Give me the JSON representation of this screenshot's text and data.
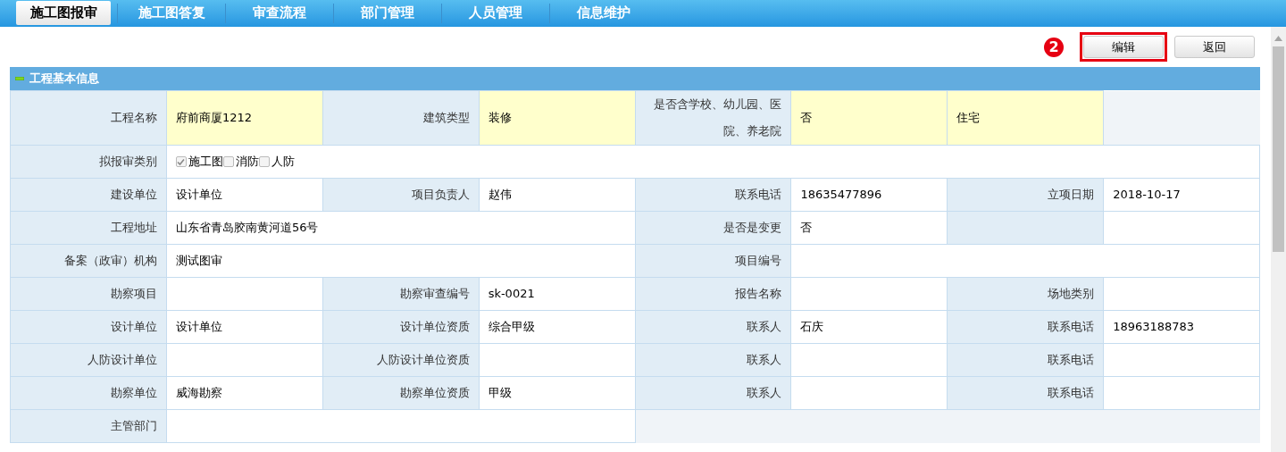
{
  "nav": {
    "tabs": [
      {
        "label": "施工图报审",
        "selected": true
      },
      {
        "label": "施工图答复",
        "selected": false
      },
      {
        "label": "审查流程",
        "selected": false
      },
      {
        "label": "部门管理",
        "selected": false
      },
      {
        "label": "人员管理",
        "selected": false
      },
      {
        "label": "信息维护",
        "selected": false
      }
    ]
  },
  "step_badge": "2",
  "buttons": [
    {
      "label": "编辑",
      "highlighted": true
    },
    {
      "label": "返回",
      "highlighted": false
    }
  ],
  "section": {
    "title": "工程基本信息",
    "expanded": true
  },
  "rows": [
    {
      "cells": [
        {
          "kind": "label",
          "text": "工程名称"
        },
        {
          "kind": "value",
          "text": "府前商厦1212",
          "highlighted": true
        },
        {
          "kind": "label",
          "text": "建筑类型"
        },
        {
          "kind": "value",
          "text": "装修",
          "highlighted": true
        },
        {
          "kind": "label",
          "text": "是否含学校、幼儿园、医院、养老院"
        },
        {
          "kind": "value",
          "text": "否",
          "highlighted": true
        },
        {
          "kind": "value",
          "text": "住宅",
          "highlighted": true
        }
      ]
    },
    {
      "cells": [
        {
          "kind": "label",
          "text": "拟报审类别"
        },
        {
          "kind": "checks",
          "options": [
            {
              "label": "施工图",
              "checked": true
            },
            {
              "label": "消防",
              "checked": false
            },
            {
              "label": "人防",
              "checked": false
            }
          ]
        }
      ]
    },
    {
      "cells": [
        {
          "kind": "label",
          "text": "建设单位"
        },
        {
          "kind": "value",
          "text": "设计单位"
        },
        {
          "kind": "label",
          "text": "项目负责人"
        },
        {
          "kind": "value",
          "text": "赵伟"
        },
        {
          "kind": "label",
          "text": "联系电话"
        },
        {
          "kind": "value",
          "text": "18635477896"
        },
        {
          "kind": "label",
          "text": "立项日期"
        },
        {
          "kind": "value",
          "text": "2018-10-17"
        }
      ]
    },
    {
      "cells": [
        {
          "kind": "label",
          "text": "工程地址"
        },
        {
          "kind": "wide",
          "text": "山东省青岛胶南黄河道56号"
        },
        {
          "kind": "label",
          "text": "是否是变更"
        },
        {
          "kind": "value",
          "text": "否"
        },
        {
          "kind": "label"
        },
        {
          "kind": "value"
        }
      ]
    },
    {
      "cells": [
        {
          "kind": "label",
          "text": "备案（政审）机构"
        },
        {
          "kind": "wide",
          "text": "测试图审"
        },
        {
          "kind": "label",
          "text": "项目编号"
        },
        {
          "kind": "wide"
        }
      ]
    },
    {
      "cells": [
        {
          "kind": "label",
          "text": "勘察项目"
        },
        {
          "kind": "value"
        },
        {
          "kind": "label",
          "text": "勘察审查编号"
        },
        {
          "kind": "value",
          "text": "sk-0021"
        },
        {
          "kind": "label",
          "text": "报告名称"
        },
        {
          "kind": "value"
        },
        {
          "kind": "label",
          "text": "场地类别"
        },
        {
          "kind": "value"
        }
      ]
    },
    {
      "cells": [
        {
          "kind": "label",
          "text": "设计单位"
        },
        {
          "kind": "value",
          "text": "设计单位"
        },
        {
          "kind": "label",
          "text": "设计单位资质"
        },
        {
          "kind": "value",
          "text": "综合甲级"
        },
        {
          "kind": "label",
          "text": "联系人"
        },
        {
          "kind": "value",
          "text": "石庆"
        },
        {
          "kind": "label",
          "text": "联系电话"
        },
        {
          "kind": "value",
          "text": "18963188783"
        }
      ]
    },
    {
      "cells": [
        {
          "kind": "label",
          "text": "人防设计单位"
        },
        {
          "kind": "value"
        },
        {
          "kind": "label",
          "text": "人防设计单位资质"
        },
        {
          "kind": "value"
        },
        {
          "kind": "label",
          "text": "联系人"
        },
        {
          "kind": "value"
        },
        {
          "kind": "label",
          "text": "联系电话"
        },
        {
          "kind": "value"
        }
      ]
    },
    {
      "cells": [
        {
          "kind": "label",
          "text": "勘察单位"
        },
        {
          "kind": "value",
          "text": "威海勘察"
        },
        {
          "kind": "label",
          "text": "勘察单位资质"
        },
        {
          "kind": "value",
          "text": "甲级"
        },
        {
          "kind": "label",
          "text": "联系人"
        },
        {
          "kind": "value"
        },
        {
          "kind": "label",
          "text": "联系电话"
        },
        {
          "kind": "value"
        }
      ]
    },
    {
      "cells": [
        {
          "kind": "label",
          "text": "主管部门"
        },
        {
          "kind": "wide"
        }
      ]
    }
  ]
}
